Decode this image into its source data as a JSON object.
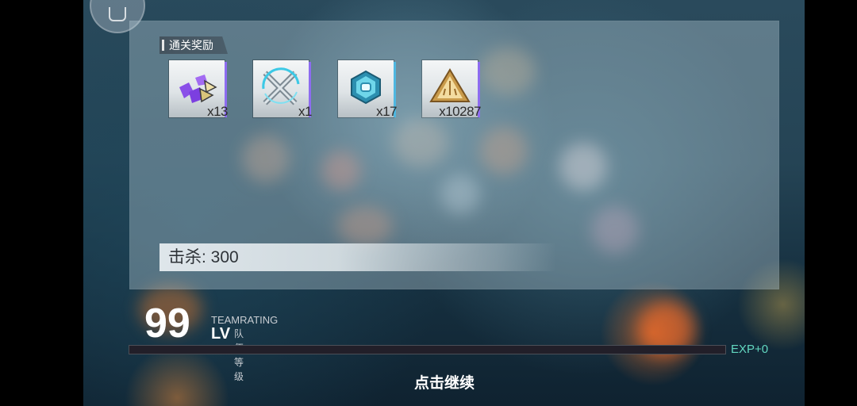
{
  "rewards_section": {
    "title": "通关奖励",
    "items": [
      {
        "name": "purple-crystal-shards",
        "count": "x13",
        "rarity_color": "#8d6cf0"
      },
      {
        "name": "crossed-swords-emblem",
        "count": "x1",
        "rarity_color": "#8d6cf0"
      },
      {
        "name": "blue-hex-chip",
        "count": "x17",
        "rarity_color": "#4fb7e0"
      },
      {
        "name": "gold-triangle-badge",
        "count": "x10287",
        "rarity_color": "#8d6cf0"
      }
    ]
  },
  "kills": {
    "label": "击杀: 300"
  },
  "team": {
    "level": "99",
    "rating_label": "TEAMRATING",
    "lv_label": "LV",
    "level_label": "队伍等级",
    "exp_gain": "EXP+0",
    "exp_progress": 0
  },
  "continue_label": "点击继续",
  "colors": {
    "exp_accent": "#62d7bf",
    "panel": "#b9cdd7"
  }
}
